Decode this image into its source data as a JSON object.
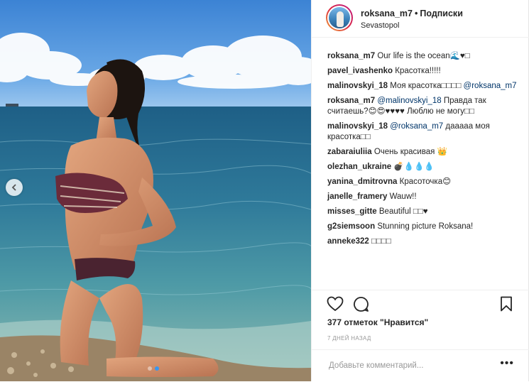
{
  "post": {
    "author": "roksana_m7",
    "header_separator": "•",
    "follow_label": "Подписки",
    "location": "Sevastopol",
    "photo_alt": "Woman kneeling on a pebble beach by the sea",
    "carousel": {
      "slides": 2,
      "current": 2
    }
  },
  "comments": [
    {
      "user": "roksana_m7",
      "text": "Our life is the ocean🌊♥□"
    },
    {
      "user": "pavel_ivashenko",
      "text": "Красотка!!!!!"
    },
    {
      "user": "malinovskyi_18",
      "text": "Моя красотка□□□□ ",
      "mention": "@roksana_m7"
    },
    {
      "user": "roksana_m7",
      "mention": "@malinovskyi_18",
      "text": "Правда так считаешь?😊😍♥♥♥♥ Люблю не могу□□"
    },
    {
      "user": "malinovskyi_18",
      "mention": "@roksana_m7",
      "text": "дааааа моя красотка□□"
    },
    {
      "user": "zabaraiuliia",
      "text": "Очень красивая 👑"
    },
    {
      "user": "olezhan_ukraine",
      "text": "💣💧💧💧"
    },
    {
      "user": "yanina_dmitrovna",
      "text": "Красоточка😊"
    },
    {
      "user": "janelle_framery",
      "text": "Wauw!!"
    },
    {
      "user": "misses_gitte",
      "text": "Beautiful □□♥"
    },
    {
      "user": "g2siemsoon",
      "text": "Stunning picture Roksana!"
    },
    {
      "user": "anneke322",
      "text": "□□□□"
    }
  ],
  "stats": {
    "likes_label": "377 отметок \"Нравится\"",
    "time_ago": "7 ДНЕЙ НАЗАД"
  },
  "add_comment": {
    "placeholder": "Добавьте комментарий...",
    "more": "•••"
  },
  "icons": {
    "like": "heart-icon",
    "comment": "comment-icon",
    "save": "bookmark-icon",
    "prev": "chevron-left-icon",
    "more": "more-options-icon"
  },
  "colors": {
    "accent": "#3897f0",
    "mention": "#003569",
    "muted": "#999999"
  }
}
